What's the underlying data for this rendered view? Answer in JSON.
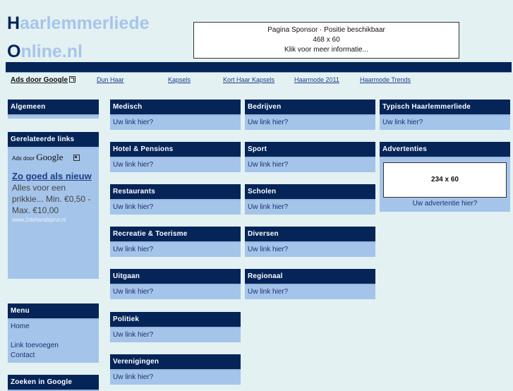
{
  "logo": {
    "line1_cap": "H",
    "line1_rest": "aarlemmerliede",
    "line2_cap": "O",
    "line2_rest": "nline.nl"
  },
  "sponsor": {
    "line1": "Pagina Sponsor · Positie beschikbaar",
    "line2": "468 x 60",
    "line3": "Klik voor meer informatie..."
  },
  "ad_links": {
    "label": "Ads door Google",
    "links": [
      "Dun Haar",
      "Kapsels",
      "Kort Haar Kapsels",
      "Haarmode 2011",
      "Haarmode Trends"
    ]
  },
  "sidebar": {
    "algemeen": {
      "title": "Algemeen"
    },
    "related": {
      "title": "Gerelateerde links",
      "ads_label": "Ads door",
      "google": "Google",
      "ad_title": "Zo goed als nieuw",
      "ad_text": "Alles voor een prikkie... Min. €0,50 - Max. €10,00",
      "ad_url": "www.2dehandsprul.nl"
    },
    "menu": {
      "title": "Menu",
      "items": [
        "Home",
        "Link toevoegen",
        "Contact"
      ]
    },
    "search": {
      "title": "Zoeken in Google"
    }
  },
  "categories": {
    "colA": [
      {
        "title": "Medisch",
        "link": "Uw link hier?"
      },
      {
        "title": "Hotel & Pensions",
        "link": "Uw link hier?"
      },
      {
        "title": "Restaurants",
        "link": "Uw link hier?"
      },
      {
        "title": "Recreatie & Toerisme",
        "link": "Uw link hier?"
      },
      {
        "title": "Uitgaan",
        "link": "Uw link hier?"
      },
      {
        "title": "Politiek",
        "link": "Uw link hier?"
      },
      {
        "title": "Verenigingen",
        "link": "Uw link hier?"
      }
    ],
    "colB": [
      {
        "title": "Bedrijven",
        "link": "Uw link hier?"
      },
      {
        "title": "Sport",
        "link": "Uw link hier?"
      },
      {
        "title": "Scholen",
        "link": "Uw link hier?"
      },
      {
        "title": "Diversen",
        "link": "Uw link hier?"
      },
      {
        "title": "Regionaal",
        "link": "Uw link hier?"
      }
    ],
    "colC": [
      {
        "title": "Typisch Haarlemmerliede",
        "link": "Uw link hier?"
      }
    ]
  },
  "advertenties": {
    "title": "Advertenties",
    "box": "234 x 60",
    "link": "Uw advertentie hier?"
  },
  "colors": {
    "dark": "#052458",
    "light": "#a5c4e9",
    "bg": "#e3f1f3",
    "logo_light": "#a7c5ea"
  }
}
